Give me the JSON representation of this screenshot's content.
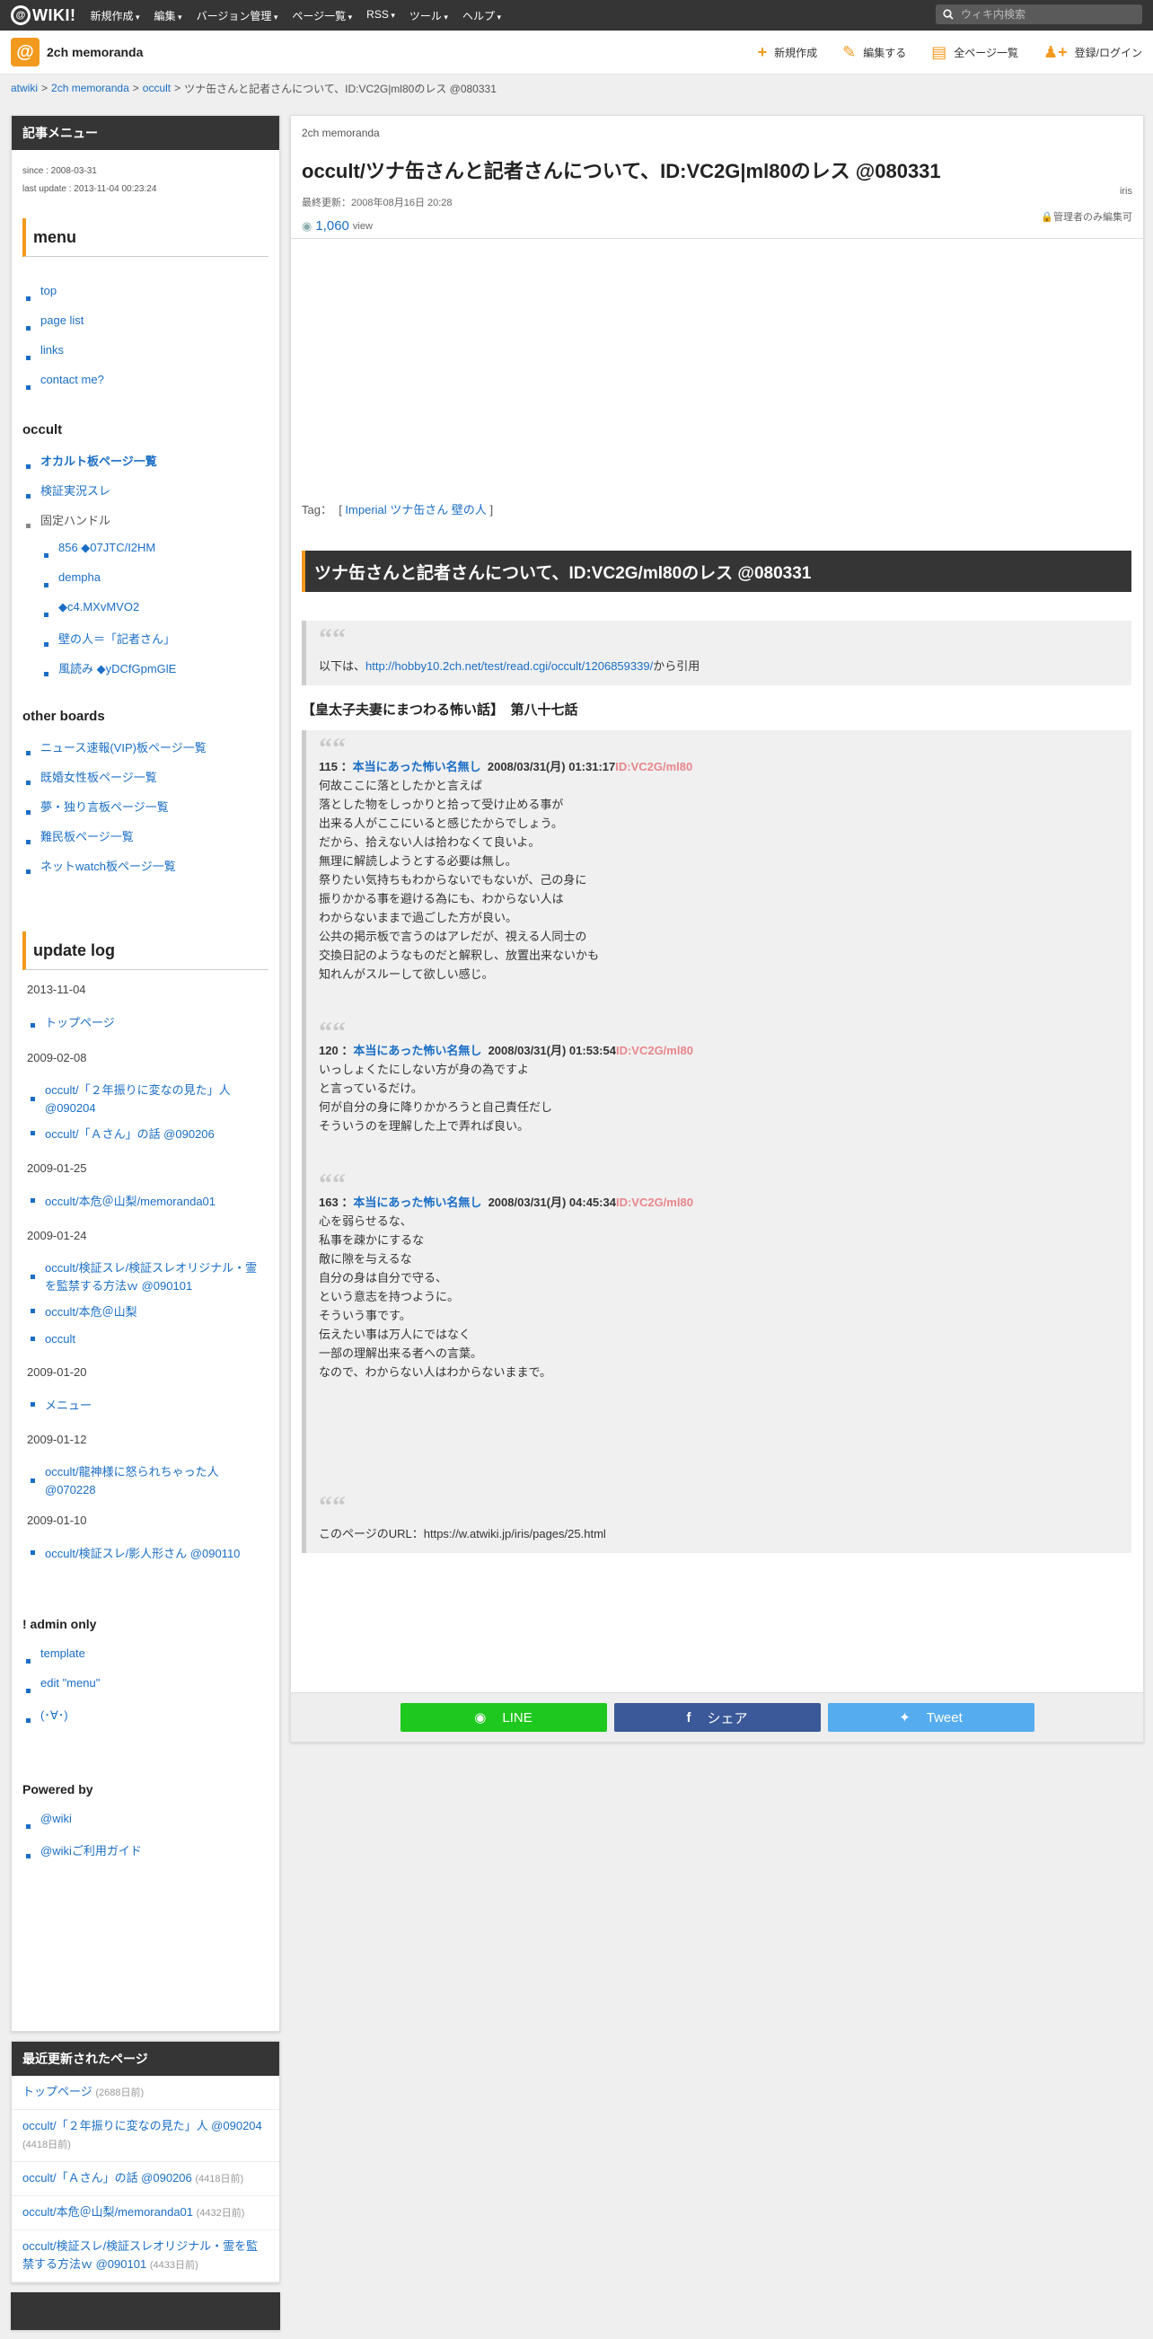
{
  "topbar": {
    "logo_text": "WIKI!",
    "nav": [
      "新規作成",
      "編集",
      "バージョン管理",
      "ページ一覧",
      "RSS",
      "ツール",
      "ヘルプ"
    ],
    "search_placeholder": "ウィキ内検索"
  },
  "site": {
    "name": "2ch memoranda",
    "actions": [
      {
        "label": "新規作成",
        "icon": "plus-icon"
      },
      {
        "label": "編集する",
        "icon": "pencil-icon"
      },
      {
        "label": "全ページ一覧",
        "icon": "document-icon"
      },
      {
        "label": "登録/ログイン",
        "icon": "user-plus-icon"
      }
    ]
  },
  "breadcrumb": [
    "atwiki",
    "2ch memoranda",
    "occult",
    "ツナ缶さんと記者さんについて、ID:VC2G|ml80のレス @080331"
  ],
  "sidebar": {
    "menu_panel_title": "記事メニュー",
    "since": "since : 2008-03-31",
    "last_update": "last update : 2013-11-04 00:23:24",
    "menu_heading": "menu",
    "menu_links": [
      "top",
      "page list",
      "links",
      "contact me?"
    ],
    "occult_heading": "occult",
    "occult_links": [
      "オカルト板ページ一覧",
      "検証実況スレ"
    ],
    "handle_label": "固定ハンドル",
    "handles": [
      "856 ◆07JTC/I2HM",
      "dempha",
      "◆c4.MXvMVO2",
      "壁の人＝「記者さん」",
      "風読み ◆yDCfGpmGlE"
    ],
    "other_heading": "other boards",
    "other_links": [
      "ニュース速報(VIP)板ページ一覧",
      "既婚女性板ページ一覧",
      "夢・独り言板ページ一覧",
      "難民板ページ一覧",
      "ネットwatch板ページ一覧"
    ],
    "update_heading": "update log",
    "update_log": [
      {
        "date": "2013-11-04",
        "items": [
          "トップページ"
        ]
      },
      {
        "date": "2009-02-08",
        "items": [
          "occult/「２年振りに変なの見た」人 @090204",
          "occult/「Ａさん」の話 @090206"
        ]
      },
      {
        "date": "2009-01-25",
        "items": [
          "occult/本危＠山梨/memoranda01"
        ]
      },
      {
        "date": "2009-01-24",
        "items": [
          "occult/検証スレ/検証スレオリジナル・霊を監禁する方法ｗ @090101",
          "occult/本危＠山梨",
          "occult"
        ]
      },
      {
        "date": "2009-01-20",
        "items": [
          "メニュー"
        ]
      },
      {
        "date": "2009-01-12",
        "items": [
          "occult/龍神様に怒られちゃった人 @070228"
        ]
      },
      {
        "date": "2009-01-10",
        "items": [
          "occult/検証スレ/影人形さん @090110"
        ]
      }
    ],
    "admin_heading": "! admin only",
    "admin_links": [
      "template",
      "edit \"menu\"",
      "(･∀･)"
    ],
    "powered_heading": "Powered by",
    "powered_links": [
      "@wiki",
      "@wikiご利用ガイド"
    ],
    "recent_panel_title": "最近更新されたページ",
    "recent": [
      {
        "label": "トップページ",
        "days": "(2688日前)"
      },
      {
        "label": "occult/「２年振りに変なの見た」人 @090204",
        "days": "(4418日前)"
      },
      {
        "label": "occult/「Ａさん」の話 @090206",
        "days": "(4418日前)"
      },
      {
        "label": "occult/本危＠山梨/memoranda01",
        "days": "(4432日前)"
      },
      {
        "label": "occult/検証スレ/検証スレオリジナル・霊を監禁する方法ｗ @090101",
        "days": "(4433日前)"
      }
    ]
  },
  "page": {
    "wiki_name": "2ch memoranda",
    "title": "occult/ツナ缶さんと記者さんについて、ID:VC2G|ml80のレス @080331",
    "updated": "最終更新：2008年08月16日 20:28",
    "author": "iris",
    "views": "1,060",
    "views_unit": "view",
    "permission": "管理者のみ編集可",
    "tag_label": "Tag：",
    "tags": "Imperial ツナ缶さん 壁の人",
    "section_title": "ツナ缶さんと記者さんについて、ID:VC2G/ml80のレス @080331",
    "cite_prefix": "以下は、",
    "cite_url": "http://hobby10.2ch.net/test/read.cgi/occult/1206859339/",
    "cite_suffix": "から引用",
    "subheading": "【皇太子夫妻にまつわる怖い話】　第八十七話",
    "posts": [
      {
        "num": "115",
        "name": "本当にあった怖い名無し",
        "date": "2008/03/31(月) 01:31:17",
        "id": "ID:VC2G/ml80",
        "lines": [
          "何故ここに落としたかと言えば",
          "落とした物をしっかりと拾って受け止める事が",
          "出来る人がここにいると感じたからでしょう。",
          "だから、拾えない人は拾わなくて良いよ。",
          "無理に解読しようとする必要は無し。",
          "祭りたい気持ちもわからないでもないが、己の身に",
          "振りかかる事を避ける為にも、わからない人は",
          "わからないままで過ごした方が良い。",
          "公共の掲示板で言うのはアレだが、視える人同士の",
          "交換日記のようなものだと解釈し、放置出来ないかも",
          "知れんがスルーして欲しい感じ。"
        ]
      },
      {
        "num": "120",
        "name": "本当にあった怖い名無し",
        "date": "2008/03/31(月) 01:53:54",
        "id": "ID:VC2G/ml80",
        "lines": [
          "いっしょくたにしない方が身の為ですよ",
          "と言っているだけ。",
          "何が自分の身に降りかかろうと自己責任だし",
          "そういうのを理解した上で弄れば良い。"
        ]
      },
      {
        "num": "163",
        "name": "本当にあった怖い名無し",
        "date": "2008/03/31(月) 04:45:34",
        "id": "ID:VC2G/ml80",
        "lines": [
          "心を弱らせるな、",
          "私事を疎かにするな",
          "敵に隙を与えるな",
          "自分の身は自分で守る、",
          "という意志を持つように。",
          "そういう事です。",
          "伝えたい事は万人にではなく",
          "一部の理解出来る者への言葉。",
          "なので、わからない人はわからないままで。"
        ]
      }
    ],
    "url_label": "このページのURL：",
    "url": "https://w.atwiki.jp/iris/pages/25.html",
    "share": {
      "line": "LINE",
      "facebook": "シェア",
      "twitter": "Tweet"
    }
  },
  "colors": {
    "accent": "#f29a1e",
    "link": "#1a6ec6",
    "dark": "#353535",
    "id_text": "#e8868c",
    "line": "#1ec81e",
    "facebook": "#3b5998",
    "twitter": "#55acee"
  }
}
